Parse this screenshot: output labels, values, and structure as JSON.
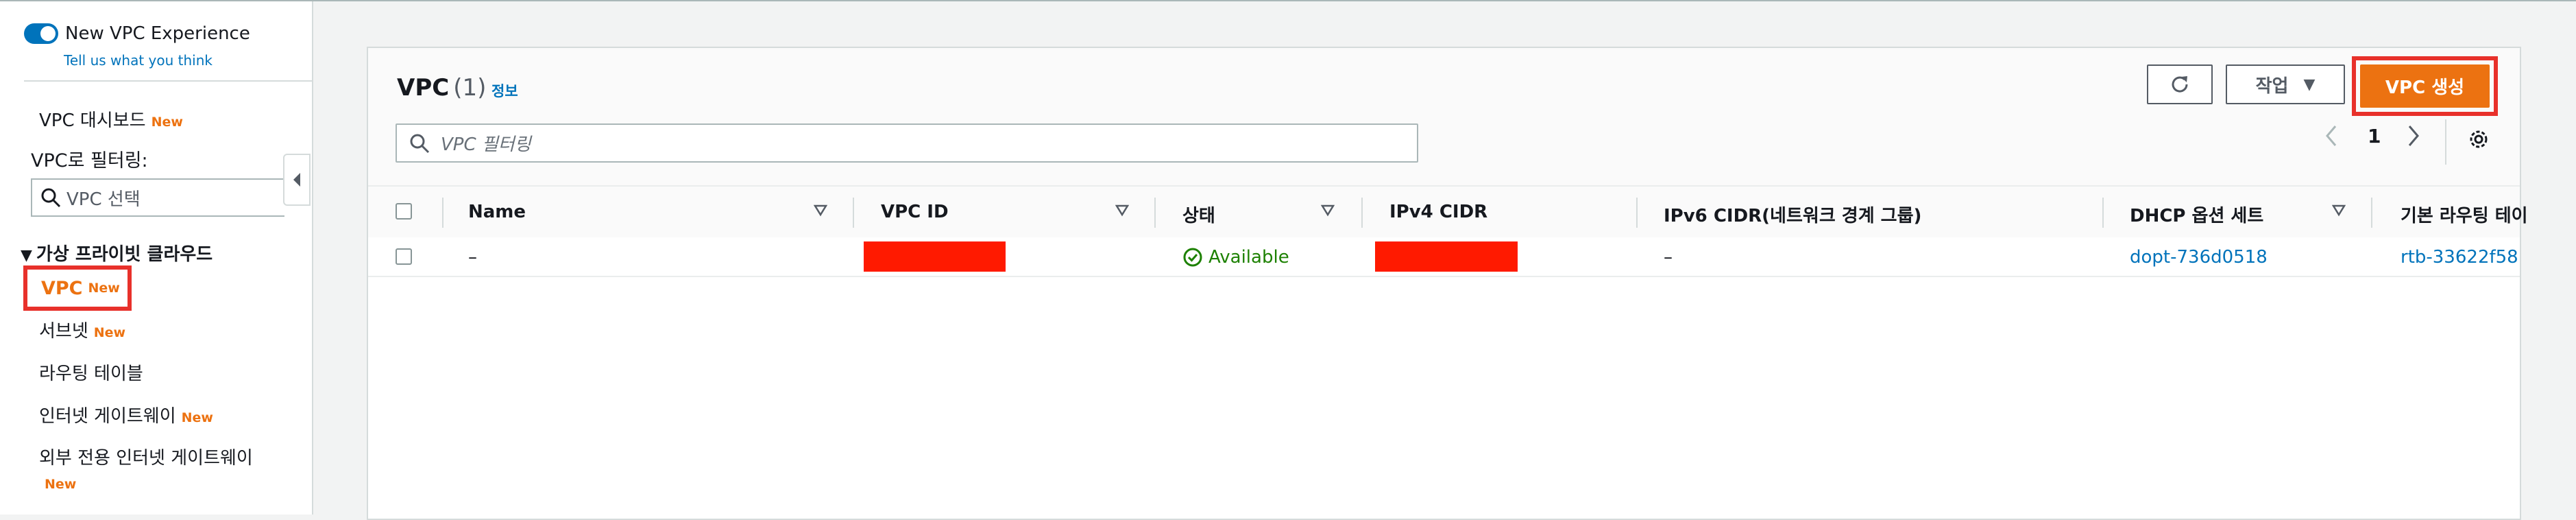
{
  "sidebar": {
    "experience_label": "New VPC Experience",
    "feedback_link": "Tell us what you think",
    "dashboard_label": "VPC 대시보드",
    "new_badge": "New",
    "filter_label": "VPC로 필터링:",
    "filter_placeholder": "VPC 선택",
    "section_title": "가상 프라이빗 클라우드",
    "items": [
      {
        "label": "VPC",
        "new": "New"
      },
      {
        "label": "서브넷",
        "new": "New"
      },
      {
        "label": "라우팅 테이블"
      },
      {
        "label": "인터넷 게이트웨이",
        "new": "New"
      },
      {
        "label": "외부 전용 인터넷 게이트웨이",
        "new": "New"
      }
    ]
  },
  "panel": {
    "title": "VPC",
    "count": "(1)",
    "info_link": "정보",
    "action_button": "작업",
    "create_button": "VPC 생성",
    "search_placeholder": "VPC 필터링",
    "page_number": "1"
  },
  "table": {
    "columns": [
      "Name",
      "VPC ID",
      "상태",
      "IPv4 CIDR",
      "IPv6 CIDR(네트워크 경계 그룹)",
      "DHCP 옵션 세트",
      "기본 라우팅 테이"
    ],
    "rows": [
      {
        "name": "–",
        "vpc_id": "",
        "status": "Available",
        "ipv4": "",
        "ipv6": "–",
        "dhcp": "dopt-736d0518",
        "route_table": "rtb-33622f58"
      }
    ]
  },
  "colors": {
    "accent": "#ec7211",
    "link": "#0073bb",
    "highlight": "#e8312b",
    "redaction": "#ff1a00",
    "success": "#1d8102"
  }
}
